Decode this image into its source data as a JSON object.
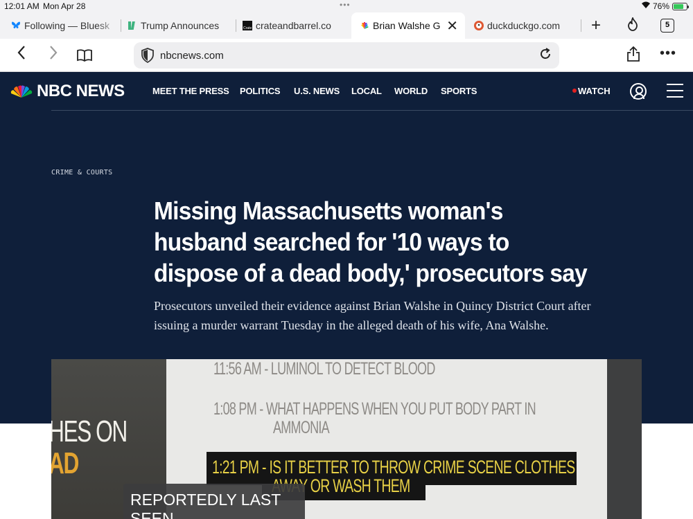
{
  "status_bar": {
    "time": "12:01 AM",
    "date": "Mon Apr 28",
    "battery_percent": "76%"
  },
  "tabs": [
    {
      "label": "Following — Bluesk",
      "icon": "bluesky-butterfly-icon",
      "active": false
    },
    {
      "label": "Trump Announces",
      "icon": "site-favicon-icon",
      "active": false
    },
    {
      "label": "crateandbarrel.co",
      "icon": "crate-barrel-icon",
      "active": false
    },
    {
      "label": "Brian Walshe G",
      "icon": "nbc-peacock-icon",
      "active": true
    },
    {
      "label": "duckduckgo.com",
      "icon": "duckduckgo-icon",
      "active": false
    }
  ],
  "tab_count": "5",
  "address_bar": {
    "url": "nbcnews.com"
  },
  "site": {
    "logo": "NBC NEWS",
    "nav": [
      "MEET THE PRESS",
      "POLITICS",
      "U.S. NEWS",
      "LOCAL",
      "WORLD",
      "SPORTS"
    ],
    "watch": "WATCH"
  },
  "article": {
    "eyebrow": "CRIME & COURTS",
    "headline": "Missing Massachusetts woman's husband searched for '10 ways to dispose of a dead body,' prosecutors say",
    "dek": "Prosecutors unveiled their evidence against Brian Walshe in Quincy District Court after issuing a murder warrant Tuesday in the alleged death of his wife, Ana Walshe."
  },
  "hero_image": {
    "side_text_1": "HES ON",
    "side_text_2": "AD",
    "lines": [
      "11:56 AM - LUMINOL TO DETECT BLOOD",
      "1:08 PM - WHAT HAPPENS WHEN YOU PUT BODY PART IN",
      "AMMONIA"
    ],
    "highlight_lines": [
      "1:21 PM - IS IT BETTER TO THROW CRIME SCENE CLOTHES",
      "AWAY OR WASH THEM"
    ],
    "caption": "REPORTEDLY LAST SEEN"
  }
}
